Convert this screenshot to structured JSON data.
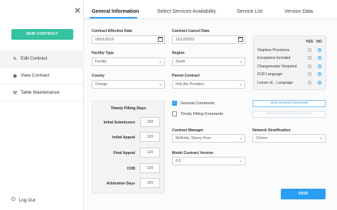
{
  "sidebar": {
    "new_contract_label": "NEW CONTRACT",
    "items": [
      {
        "label": "Edit Contract",
        "icon": "pencil-icon"
      },
      {
        "label": "View Contract",
        "icon": "eye-icon"
      },
      {
        "label": "Table Maintenance",
        "icon": "wrench-icon"
      }
    ],
    "logout_label": "Log Out"
  },
  "tabs": [
    {
      "label": "General Information",
      "active": true
    },
    {
      "label": "Select Services Availability"
    },
    {
      "label": "Service List"
    },
    {
      "label": "Version Data"
    }
  ],
  "form": {
    "effective_date": {
      "label": "Contract Effective Date",
      "value": "06/01/2019"
    },
    "cancel_date": {
      "label": "Contract Cancel Date",
      "value": "12/12/2023"
    },
    "facility_type": {
      "label": "Facility Type",
      "value": "Facility"
    },
    "region": {
      "label": "Region",
      "value": "South"
    },
    "county": {
      "label": "County",
      "value": "Orange"
    },
    "parent_contract": {
      "label": "Parent Contract",
      "value": "N/A (No Provider)"
    },
    "contract_manager": {
      "label": "Contract Manager",
      "value": "McBride, Sherry Foxx"
    },
    "network_stratification": {
      "label": "Network Stratification",
      "value": "Choice"
    },
    "model_contract_version": {
      "label": "Model Contract Version",
      "value": "6.5"
    }
  },
  "timely_filling": {
    "title": "Timely Filling Days",
    "rows": [
      {
        "label": "Initial Submission",
        "value": "120"
      },
      {
        "label": "Initial Appeal",
        "value": "120"
      },
      {
        "label": "Final Appeal",
        "value": "120"
      },
      {
        "label": "COB",
        "value": "120"
      },
      {
        "label": "Arbitration Days",
        "value": "120"
      }
    ]
  },
  "comments": {
    "general_label": "General Comments",
    "general_checked": true,
    "timely_label": "Timely Filling Comments",
    "timely_checked": false,
    "view_general_label": "View General Comments",
    "view_timely_label": "View Timely Filling Comments"
  },
  "yes_no": {
    "yes_header": "YES",
    "no_header": "NO",
    "items": [
      {
        "label": "Stopless Provisions",
        "value": "no"
      },
      {
        "label": "Exceptions Included",
        "value": "no"
      },
      {
        "label": "Chargemaster Required",
        "value": "no"
      },
      {
        "label": "FCR Language",
        "value": "no"
      },
      {
        "label": "Lesser of... Language",
        "value": "no"
      }
    ]
  },
  "save_label": "SAVE",
  "colors": {
    "accent": "#2a9df4",
    "new_contract": "#33c3a0"
  }
}
